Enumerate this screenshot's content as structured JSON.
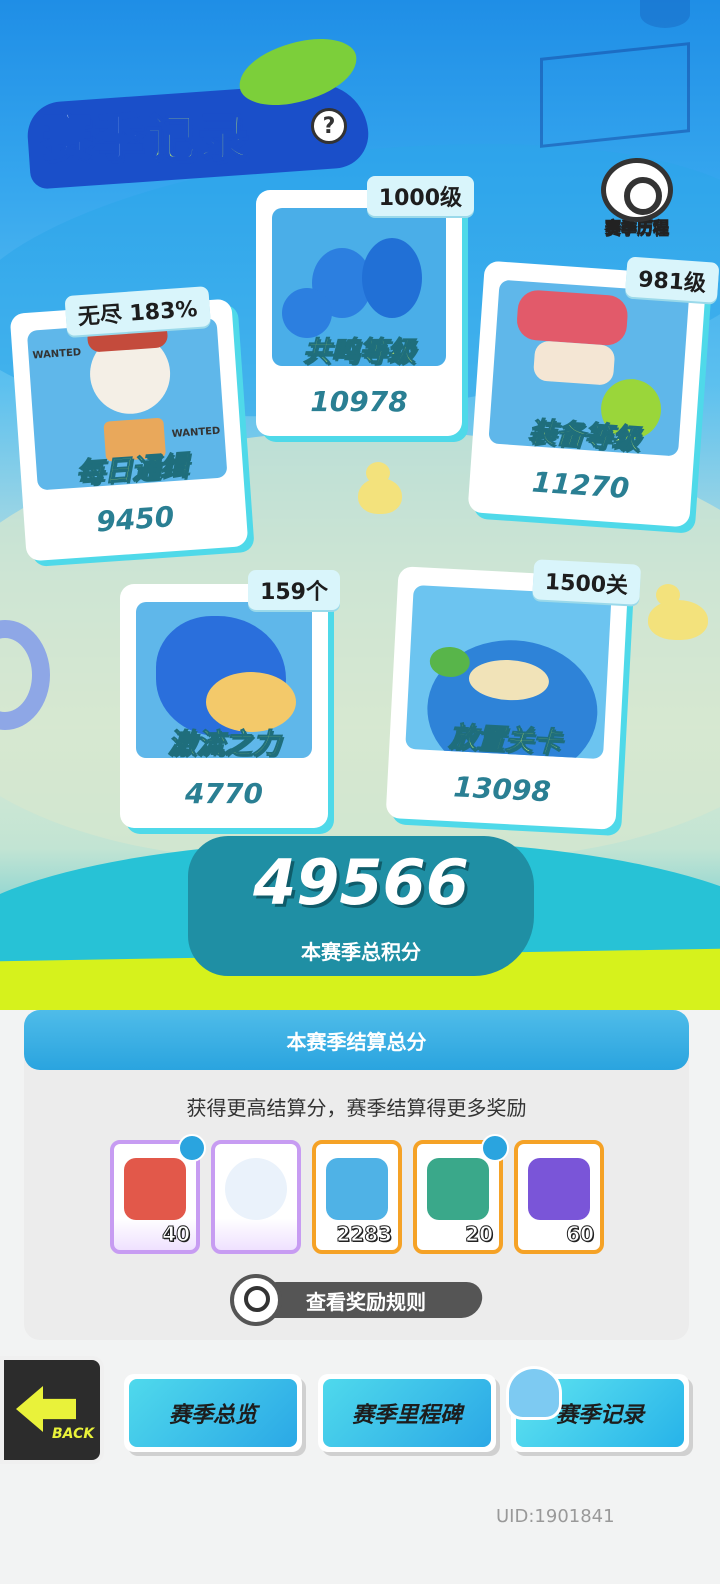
{
  "header": {
    "title": "赛季记录",
    "help_label": "?",
    "history_button_label": "赛季历程"
  },
  "cards": [
    {
      "id": "daily",
      "name": "每日通缉",
      "score": "9450",
      "tag": "无尽 183%"
    },
    {
      "id": "resonance",
      "name": "共鸣等级",
      "score": "10978",
      "tag": "1000级"
    },
    {
      "id": "equipment",
      "name": "装备等级",
      "score": "11270",
      "tag": "981级"
    },
    {
      "id": "torrent",
      "name": "激流之力",
      "score": "4770",
      "tag": "159个"
    },
    {
      "id": "idle",
      "name": "放置关卡",
      "score": "13098",
      "tag": "1500关"
    }
  ],
  "card_art_labels": {
    "wanted_left": "WANTED",
    "wanted_right": "WANTED"
  },
  "total": {
    "score": "49566",
    "label": "本赛季总积分"
  },
  "settlement": {
    "header": "本赛季结算总分",
    "subtitle": "获得更高结算分，赛季结算得更多奖励",
    "rewards": [
      {
        "icon": "lion-dance-ticket-icon",
        "qty": "40",
        "style": "rainbow",
        "badge": true
      },
      {
        "icon": "sailor-bear-icon",
        "qty": "",
        "style": "rainbow",
        "badge": false
      },
      {
        "icon": "globe-ticket-icon",
        "qty": "2283",
        "style": "orange",
        "badge": false
      },
      {
        "icon": "shell-ticket-icon",
        "qty": "20",
        "style": "orange",
        "badge": true
      },
      {
        "icon": "purple-ticket-icon",
        "qty": "60",
        "style": "orange",
        "badge": false
      }
    ],
    "rules_button": "查看奖励规则"
  },
  "nav": {
    "back_label": "BACK",
    "tabs": [
      {
        "label": "赛季总览",
        "active": false
      },
      {
        "label": "赛季里程碑",
        "active": false
      },
      {
        "label": "赛季记录",
        "active": true
      }
    ]
  },
  "uid": "UID:1901841",
  "colors": {
    "accent_cyan": "#4fd9e9",
    "lime": "#c8f36b",
    "panel_blue": "#2aa4df",
    "score_teal": "#2a7f93"
  }
}
